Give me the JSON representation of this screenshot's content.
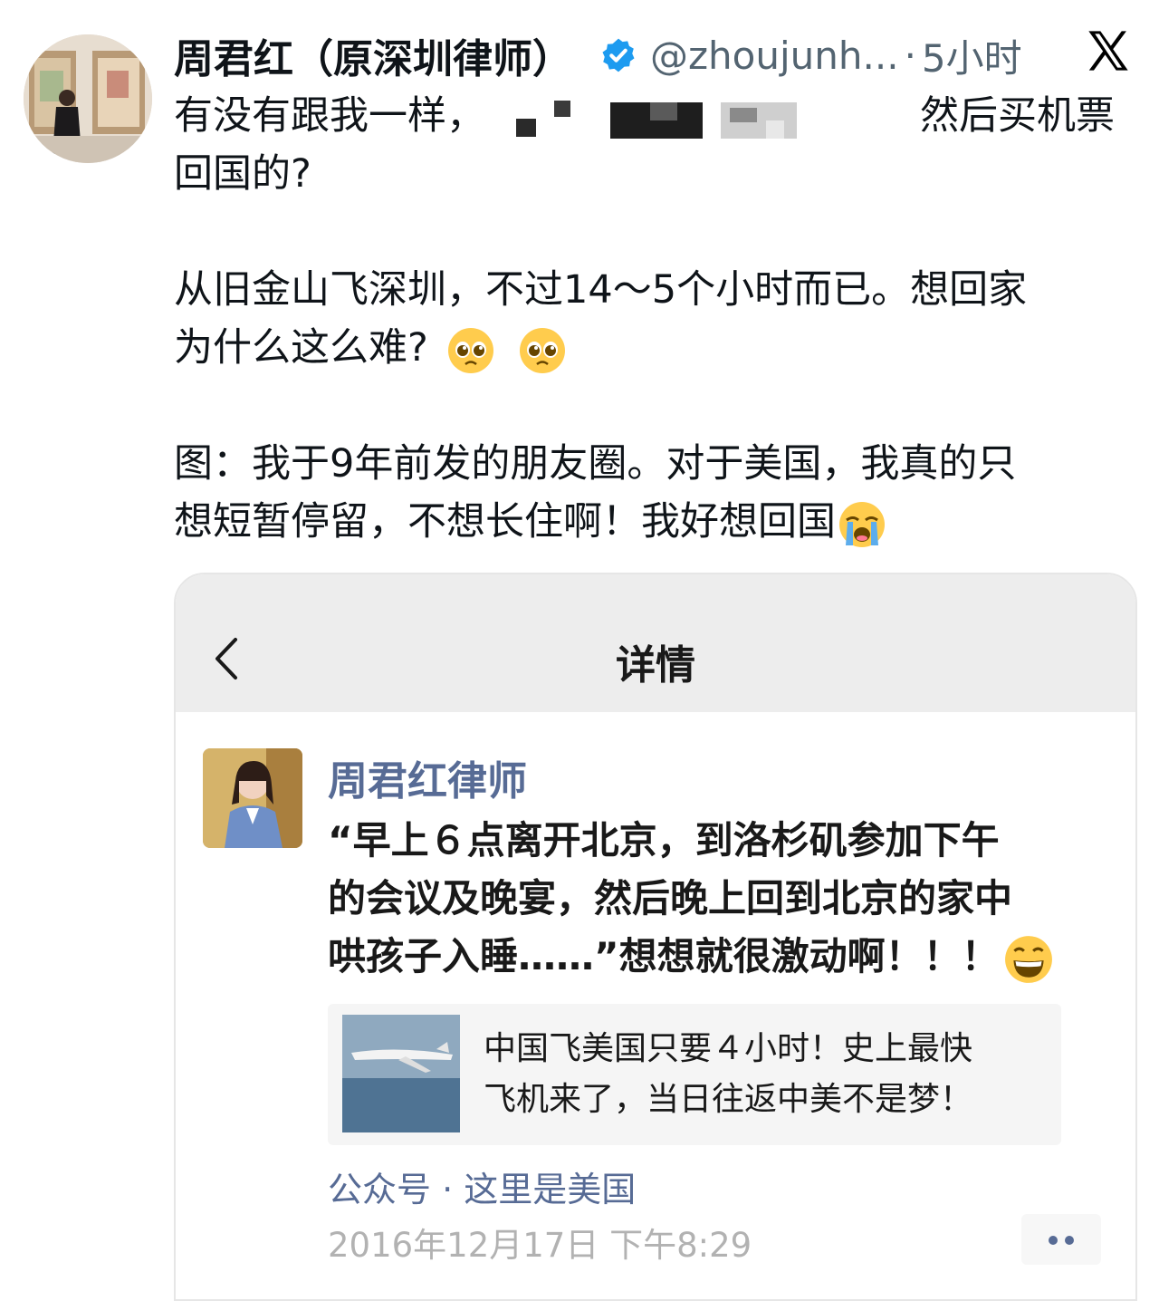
{
  "tweet": {
    "display_name": "周君红（原深圳律师）",
    "handle": "@zhoujunh...",
    "separator": "·",
    "time": "5小时",
    "platform_icon": "x-logo-icon",
    "verified_icon": "verified-badge-icon",
    "text": {
      "line1_before": "有没有跟我一样，",
      "line1_after": "然后买机票",
      "line2": "回国的?",
      "para2_line1": "从旧金山飞深圳，不过14～5个小时而已。想回家",
      "para2_line2": "为什么这么难?",
      "para3_line1": "图：我于9年前发的朋友圈。对于美国，我真的只",
      "para3_line2": "想短暂停留，不想长住啊！我好想回国"
    }
  },
  "card": {
    "nav_title": "详情",
    "author": "周君红律师",
    "moment_line1": "“早上６点离开北京，到洛杉矶参加下午",
    "moment_line2": "的会议及晚宴，然后晚上回到北京的家中",
    "moment_line3": "哄孩子入睡……”想想就很激动啊！！！",
    "link_title_line1": "中国飞美国只要４小时！史上最快",
    "link_title_line2": "飞机来了，当日往返中美不是梦！",
    "source": "公众号 · 这里是美国",
    "post_time": "2016年12月17日 下午8:29"
  },
  "colors": {
    "accent_link": "#576b95",
    "verified": "#1d9bf0",
    "secondary_text": "#536471",
    "time_gray": "#b2b2b2"
  }
}
